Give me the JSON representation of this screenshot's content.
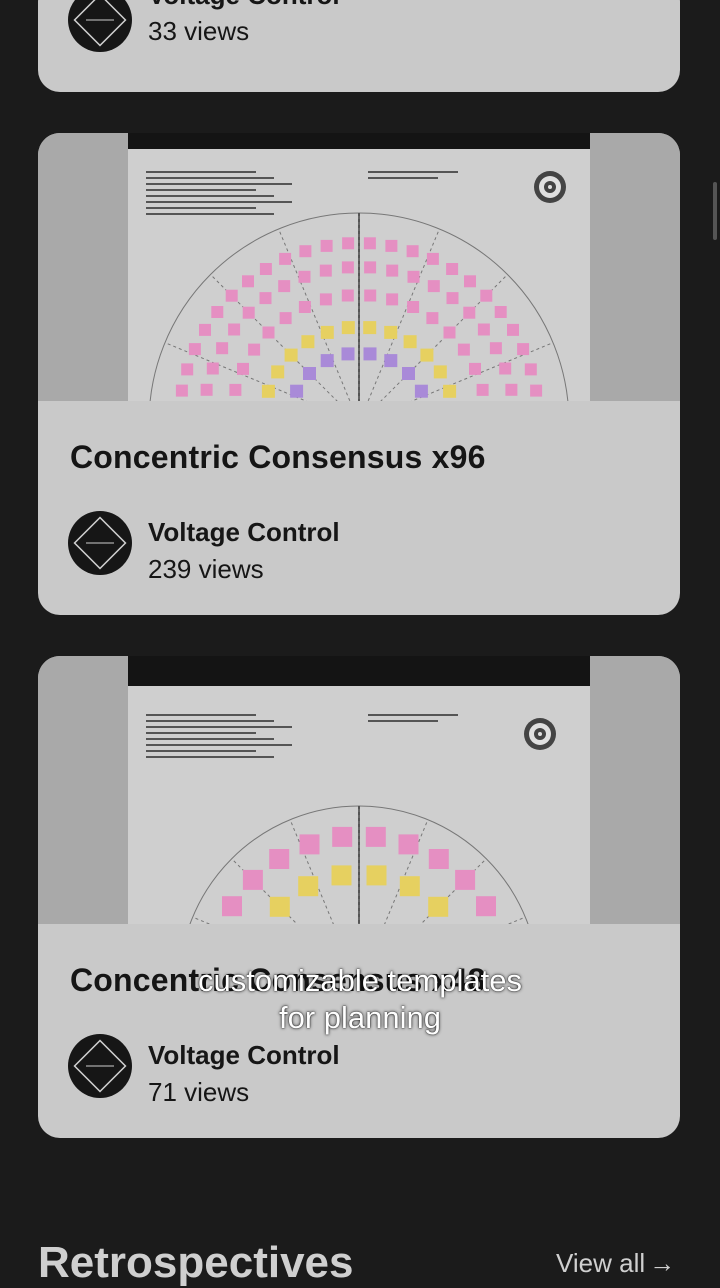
{
  "cards": [
    {
      "title": "",
      "author": "Voltage Control",
      "views": "33 views"
    },
    {
      "title": "Concentric Consensus x96",
      "author": "Voltage Control",
      "views": "239 views"
    },
    {
      "title": "Concentric Consensus x48",
      "author": "Voltage Control",
      "views": "71 views"
    }
  ],
  "caption": {
    "line1": "customizable templates",
    "line2": "for planning"
  },
  "section": {
    "title": "Retrospectives",
    "view_all": "View all",
    "view_all_arrow": "→"
  },
  "icons": {
    "avatar": "voltage-control-logo-icon",
    "target": "target-icon",
    "arrow": "arrow-right-icon"
  },
  "colors": {
    "background": "#1b1b1b",
    "card": "#c9c9c9",
    "sticky_pink": "#e58fc2",
    "sticky_yellow": "#e6d060",
    "sticky_purple": "#a98ad8"
  }
}
